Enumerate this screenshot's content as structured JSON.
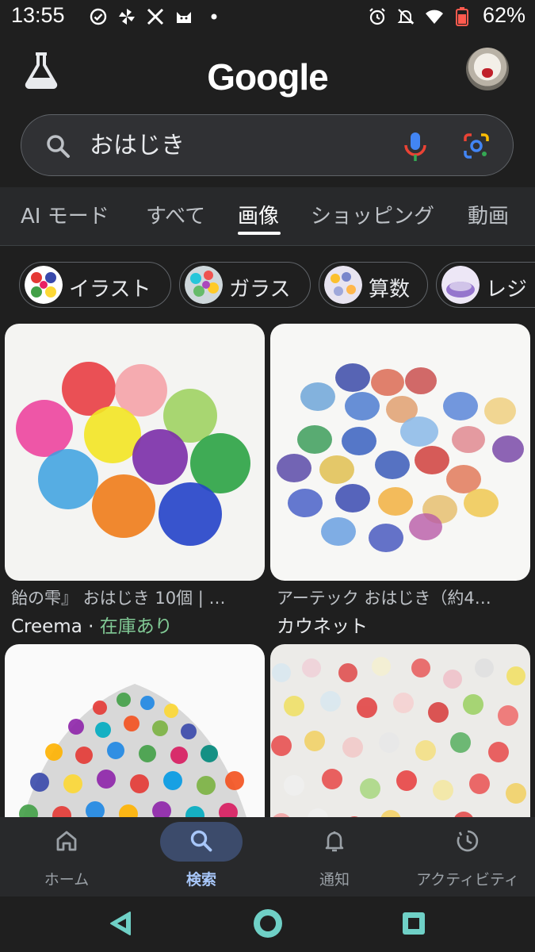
{
  "status_bar": {
    "time": "13:55",
    "battery": "62%",
    "left_icons": [
      "check-circle-icon",
      "pinwheel-icon",
      "x-app-icon",
      "cat-icon",
      "dot-icon"
    ],
    "right_icons": [
      "alarm-icon",
      "bell-off-icon",
      "wifi-icon",
      "battery-icon"
    ]
  },
  "header": {
    "logo": "Google",
    "search_query": "おはじき"
  },
  "tabs": [
    {
      "label": "AI モード"
    },
    {
      "label": "すべて"
    },
    {
      "label": "画像"
    },
    {
      "label": "ショッピング"
    },
    {
      "label": "動画"
    }
  ],
  "active_tab": "画像",
  "chips": [
    {
      "label": "イラスト"
    },
    {
      "label": "ガラス"
    },
    {
      "label": "算数"
    },
    {
      "label": "レジ"
    }
  ],
  "results": [
    {
      "title": "飴の雫』 おはじき 10個 | …",
      "source": "Creema",
      "separator": " · ",
      "stock": "在庫あり"
    },
    {
      "title": "アーテック おはじき（約4…",
      "source": "カウネット",
      "separator": "",
      "stock": ""
    },
    {
      "title": "",
      "source": "",
      "separator": "",
      "stock": ""
    },
    {
      "title": "",
      "source": "",
      "separator": "",
      "stock": ""
    }
  ],
  "bottom_nav": [
    {
      "label": "ホーム",
      "icon": "home-icon"
    },
    {
      "label": "検索",
      "icon": "search-icon"
    },
    {
      "label": "通知",
      "icon": "bell-icon"
    },
    {
      "label": "アクティビティ",
      "icon": "activity-icon"
    }
  ],
  "colors": {
    "background": "#1f1f1f",
    "active_nav": "#a8c7fa",
    "stock_green": "#81c995"
  }
}
